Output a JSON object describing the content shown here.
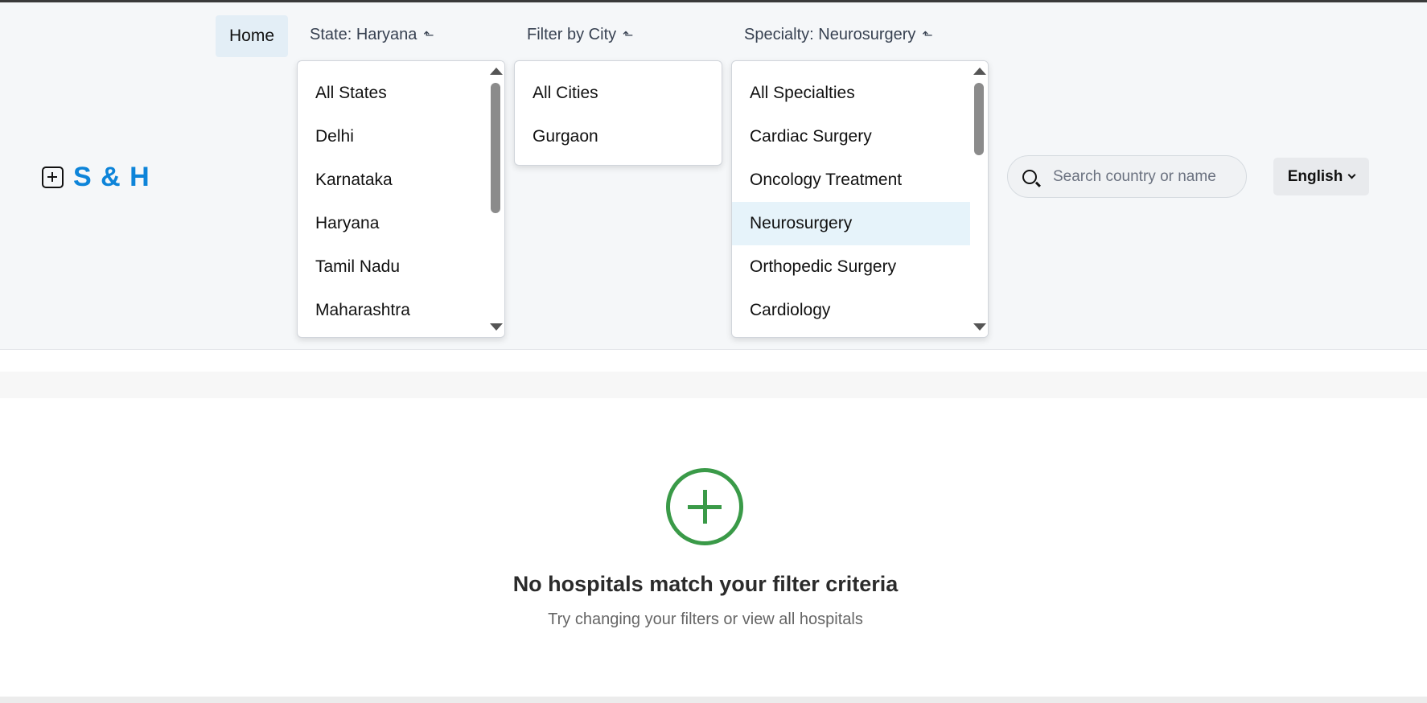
{
  "logo": {
    "text": "S & H"
  },
  "nav": {
    "home_label": "Home",
    "state_label": "State: Haryana",
    "city_label": "Filter by City",
    "specialty_label": "Specialty: Neurosurgery",
    "trigger_arrow": "⬑"
  },
  "state_dropdown": {
    "items": [
      "All States",
      "Delhi",
      "Karnataka",
      "Haryana",
      "Tamil Nadu",
      "Maharashtra"
    ]
  },
  "city_dropdown": {
    "items": [
      "All Cities",
      "Gurgaon"
    ]
  },
  "specialty_dropdown": {
    "items": [
      "All Specialties",
      "Cardiac Surgery",
      "Oncology Treatment",
      "Neurosurgery",
      "Orthopedic Surgery",
      "Cardiology"
    ],
    "selected": "Neurosurgery"
  },
  "search": {
    "placeholder": "Search country or name",
    "value": ""
  },
  "language": {
    "label": "English"
  },
  "empty_state": {
    "title": "No hospitals match your filter criteria",
    "subtitle": "Try changing your filters or view all hospitals"
  },
  "colors": {
    "brand": "#0d84d9",
    "success": "#3a9a48",
    "selected_bg": "#e6f3fa"
  }
}
